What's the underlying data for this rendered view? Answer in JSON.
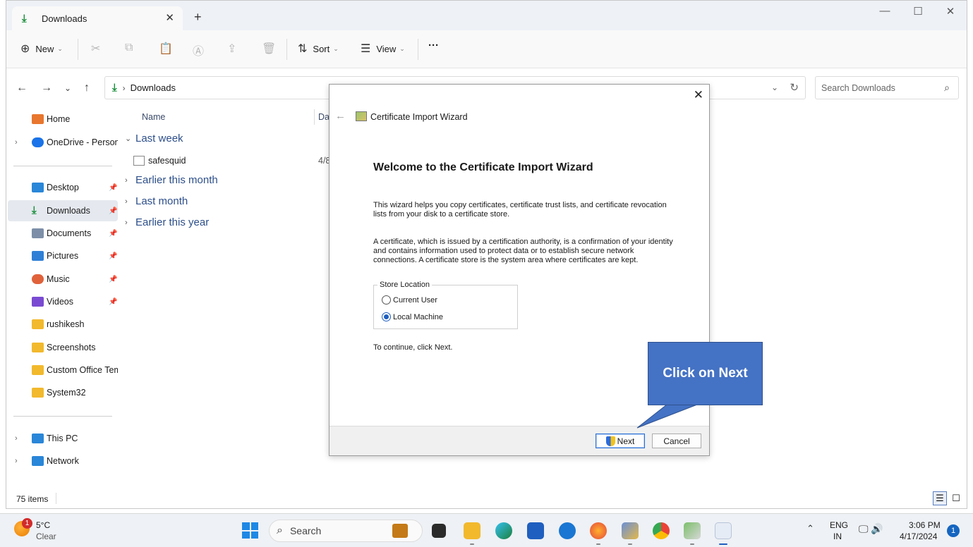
{
  "window": {
    "tab_title": "Downloads",
    "tab_close": "✕",
    "new_tab": "+",
    "minimize": "—",
    "maximize": "☐",
    "close": "✕"
  },
  "toolbar": {
    "new_label": "New",
    "sort_label": "Sort",
    "view_label": "View",
    "more_label": "···",
    "icons": [
      "cut-icon",
      "copy-icon",
      "paste-icon",
      "rename-icon",
      "share-icon",
      "delete-icon"
    ]
  },
  "address": {
    "crumb": "Downloads",
    "search_placeholder": "Search Downloads"
  },
  "sidebar": {
    "items": [
      {
        "label": "Home",
        "color": "#e8762e",
        "pinned": false,
        "expandable": false
      },
      {
        "label": "OneDrive - Persona",
        "color": "#1a73e8",
        "pinned": false,
        "expandable": true
      },
      {
        "label": "Desktop",
        "color": "#2a86d8",
        "pinned": true,
        "expandable": false
      },
      {
        "label": "Downloads",
        "color": "#1a8f3c",
        "pinned": true,
        "expandable": false
      },
      {
        "label": "Documents",
        "color": "#7d8fa8",
        "pinned": true,
        "expandable": false
      },
      {
        "label": "Pictures",
        "color": "#2f7fd6",
        "pinned": true,
        "expandable": false
      },
      {
        "label": "Music",
        "color": "#e0623b",
        "pinned": true,
        "expandable": false
      },
      {
        "label": "Videos",
        "color": "#7a4bd2",
        "pinned": true,
        "expandable": false
      },
      {
        "label": "rushikesh",
        "color": "#f2b92d",
        "pinned": false,
        "expandable": false
      },
      {
        "label": "Screenshots",
        "color": "#f2b92d",
        "pinned": false,
        "expandable": false
      },
      {
        "label": "Custom Office Tem",
        "color": "#f2b92d",
        "pinned": false,
        "expandable": false
      },
      {
        "label": "System32",
        "color": "#f2b92d",
        "pinned": false,
        "expandable": false
      },
      {
        "label": "This PC",
        "color": "#2a86d8",
        "pinned": false,
        "expandable": true
      },
      {
        "label": "Network",
        "color": "#2a86d8",
        "pinned": false,
        "expandable": true
      }
    ]
  },
  "content": {
    "col_name": "Name",
    "col_date": "Dat",
    "groups": [
      {
        "label": "Last week",
        "expanded": true
      },
      {
        "label": "Earlier this month",
        "expanded": false
      },
      {
        "label": "Last month",
        "expanded": false
      },
      {
        "label": "Earlier this year",
        "expanded": false
      }
    ],
    "file": {
      "name": "safesquid",
      "date": "4/8"
    }
  },
  "status": {
    "count": "75 items"
  },
  "dialog": {
    "title": "Certificate Import Wizard",
    "heading": "Welcome to the Certificate Import Wizard",
    "para1_line1": "This wizard helps you copy certificates, certificate trust lists, and certificate revocation",
    "para1_line2": "lists from your disk to a certificate store.",
    "para2_line1": "A certificate, which is issued by a certification authority, is a confirmation of your identity",
    "para2_line2": "and contains information used to protect data or to establish secure network",
    "para2_line3": "connections. A certificate store is the system area where certificates are kept.",
    "store_location": "Store Location",
    "option_current_user": "Current User",
    "option_local_machine": "Local Machine",
    "selected_option": "Local Machine",
    "continue_text": "To continue, click Next.",
    "next_label": "Next",
    "cancel_label": "Cancel"
  },
  "callout": {
    "text": "Click on Next",
    "color": "#4472c4"
  },
  "taskbar": {
    "weather_temp": "5°C",
    "weather_condition": "Clear",
    "weather_badge": "1",
    "search_label": "Search",
    "lang_line1": "ENG",
    "lang_line2": "IN",
    "time": "3:06 PM",
    "date": "4/17/2024",
    "notification_count": "1",
    "apps": [
      "file-explorer-icon",
      "terminal-icon",
      "folder-icon",
      "edge-icon",
      "store-icon",
      "outlook-icon",
      "firefox-icon",
      "network-tool-icon",
      "chrome-icon",
      "cert-manager-icon",
      "cert-wizard-icon"
    ]
  }
}
